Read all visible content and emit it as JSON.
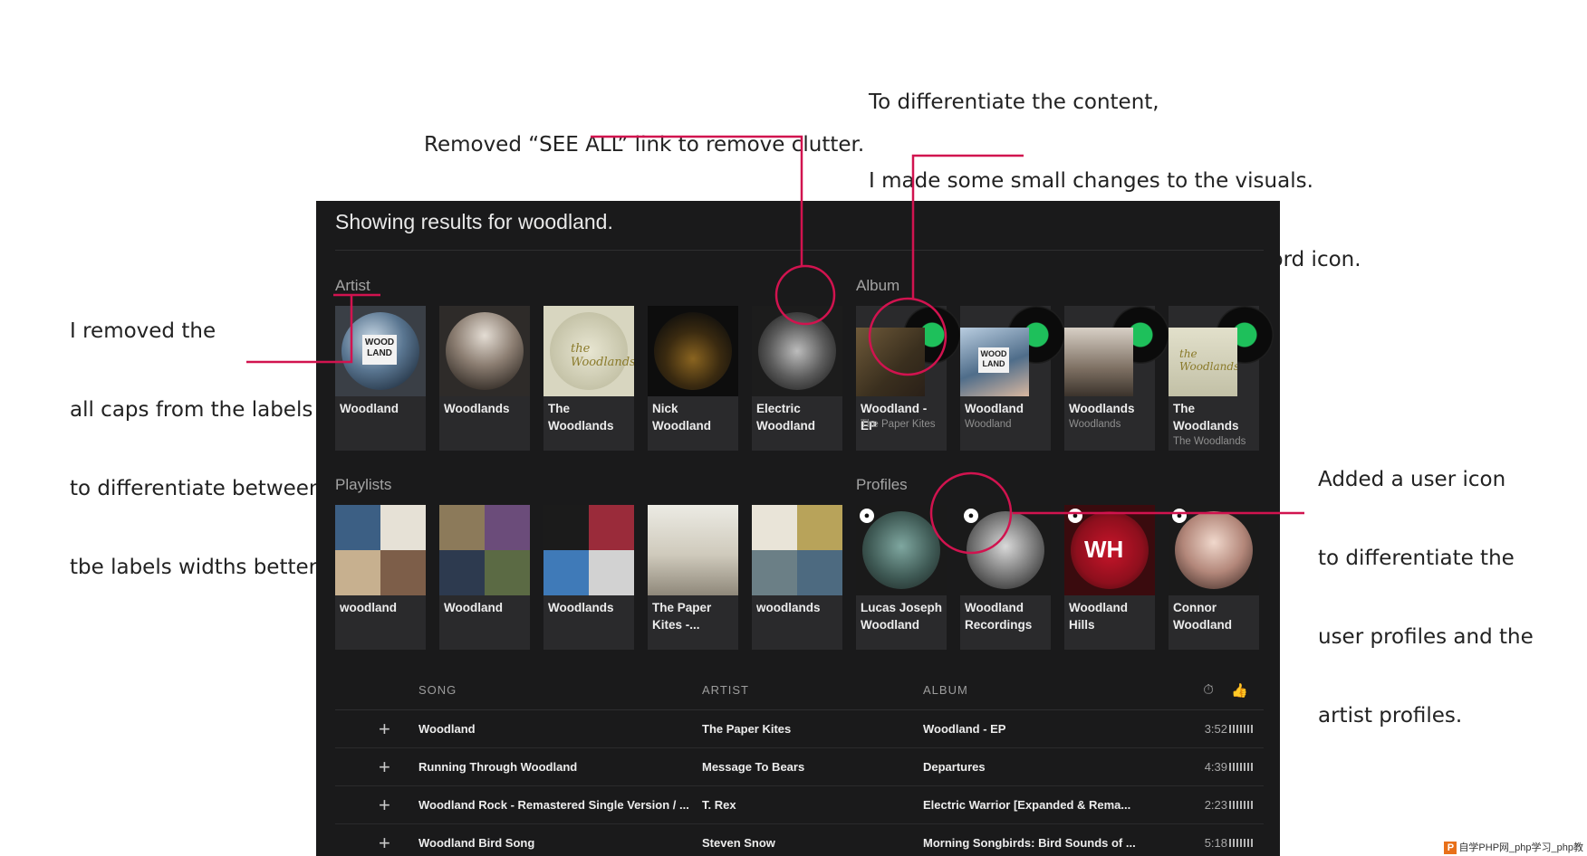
{
  "notes": {
    "see_all": "Removed “SEE ALL” link to remove clutter.",
    "visuals": [
      "To differentiate the content,",
      "I made some small changes to the visuals.",
      "For instance, for albums, I added a record icon."
    ],
    "caps": [
      "I removed the",
      "all caps from the labels",
      "to differentiate between",
      "tbe labels widths better."
    ],
    "user_icon": [
      "Added a user icon",
      "to differentiate the",
      "user profiles and the",
      "artist profiles."
    ]
  },
  "panel": {
    "title": "Showing results for woodland."
  },
  "artist": {
    "label": "Artist",
    "items": [
      {
        "name": "Woodland"
      },
      {
        "name": "Woodlands"
      },
      {
        "name": "The Woodlands"
      },
      {
        "name": "Nick Woodland"
      },
      {
        "name": "Electric Woodland"
      }
    ]
  },
  "album": {
    "label": "Album",
    "items": [
      {
        "name": "Woodland - EP",
        "artist": "The Paper Kites"
      },
      {
        "name": "Woodland",
        "artist": "Woodland"
      },
      {
        "name": "Woodlands",
        "artist": "Woodlands"
      },
      {
        "name": "The Woodlands",
        "artist": "The Woodlands"
      }
    ]
  },
  "playlists": {
    "label": "Playlists",
    "items": [
      {
        "name": "woodland"
      },
      {
        "name": "Woodland"
      },
      {
        "name": "Woodlands"
      },
      {
        "name": "The Paper Kites -..."
      },
      {
        "name": "woodlands"
      }
    ]
  },
  "profiles": {
    "label": "Profiles",
    "items": [
      {
        "name": "Lucas Joseph Woodland"
      },
      {
        "name": "Woodland Recordings"
      },
      {
        "name": "Woodland Hills"
      },
      {
        "name": "Connor Woodland"
      }
    ]
  },
  "table": {
    "headers": {
      "song": "SONG",
      "artist": "ARTIST",
      "album": "ALBUM"
    },
    "rows": [
      {
        "song": "Woodland",
        "artist": "The Paper Kites",
        "album": "Woodland - EP",
        "duration": "3:52"
      },
      {
        "song": "Running Through Woodland",
        "artist": "Message To Bears",
        "album": "Departures",
        "duration": "4:39"
      },
      {
        "song": "Woodland Rock - Remastered Single Version / ...",
        "artist": "T. Rex",
        "album": "Electric Warrior [Expanded & Rema...",
        "duration": "2:23"
      },
      {
        "song": "Woodland Bird Song",
        "artist": "Steven Snow",
        "album": "Morning Songbirds: Bird Sounds of ...",
        "duration": "5:18"
      }
    ]
  },
  "footer": {
    "logo": "P",
    "text": "自学PHP网_php学习_php教"
  },
  "colors": {
    "annotation": "#d1134f",
    "panel_bg": "#1a1a1b",
    "card_bg": "#2a2a2c",
    "record_label": "#1ec05b"
  },
  "icons": {
    "add": "plus-icon",
    "duration": "stopwatch-icon",
    "popularity": "thumbs-up-icon",
    "user": "user-icon",
    "record": "vinyl-record-icon"
  }
}
